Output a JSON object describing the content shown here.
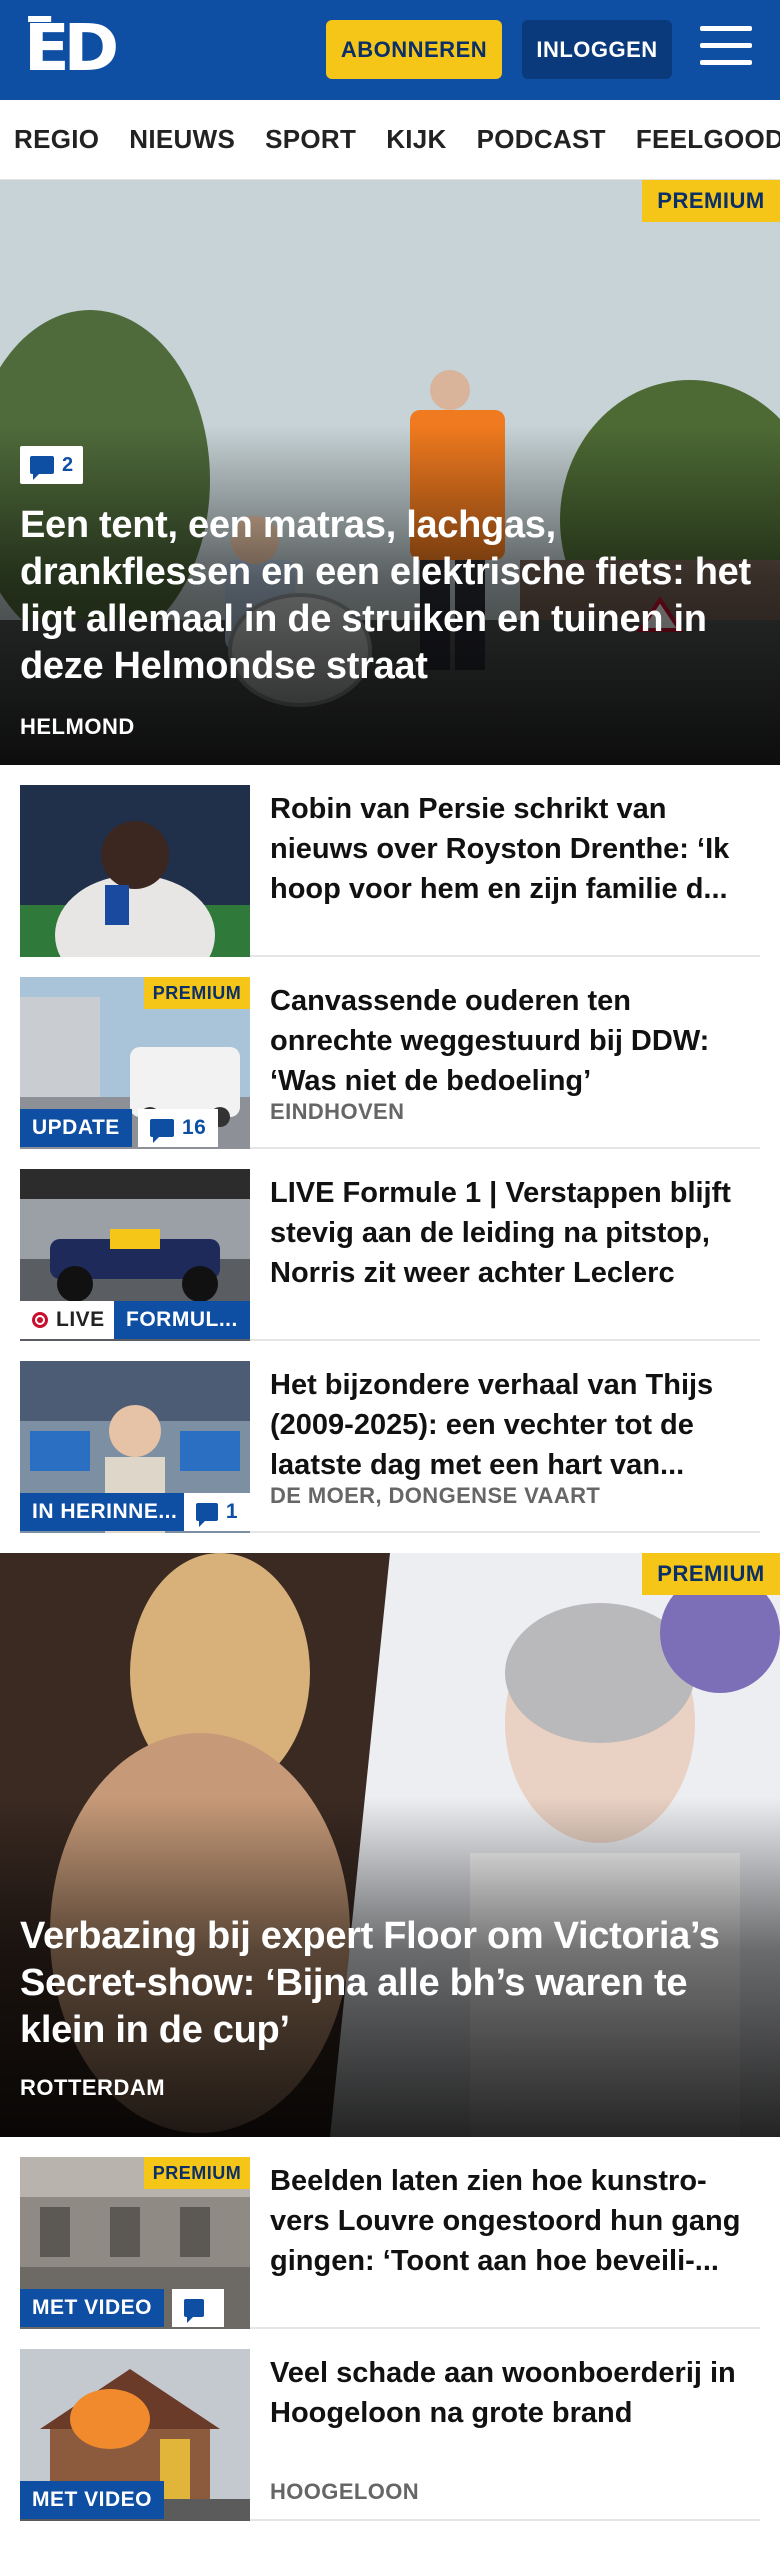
{
  "header": {
    "logo": "ED",
    "subscribe_label": "ABONNEREN",
    "login_label": "INLOGGEN",
    "accent": "#0e4fa4",
    "highlight": "#f5c518"
  },
  "nav": {
    "items": [
      "REGIO",
      "NIEUWS",
      "SPORT",
      "KIJK",
      "PODCAST",
      "FEELGOOD"
    ]
  },
  "hero1": {
    "premium_label": "PREMIUM",
    "comments": "2",
    "title": "Een tent, een matras, lachgas, drankflessen en een elektrische fiets: het ligt allemaal in de struiken en tuinen in deze Helmondse straat",
    "location": "HELMOND"
  },
  "articles": [
    {
      "title": "Robin van Persie schrikt van nieuws over Royston Drenthe: ‘Ik hoop voor hem en zijn familie d...",
      "location": ""
    },
    {
      "title": "Canvassende ouderen ten onrechte weggestuurd bij DDW: ‘Was niet de bedoeling’",
      "location": "EINDHOVEN",
      "premium_label": "PREMIUM",
      "tag": "UPDATE",
      "comments": "16"
    },
    {
      "title": "LIVE Formule 1 | Verstappen blijft stevig aan de leiding na pitstop, Norris zit weer achter Leclerc",
      "location": "",
      "live_label": "LIVE",
      "tag": "FORMUL..."
    },
    {
      "title": "Het bijzondere verhaal van Thijs (2009-2025): een vechter tot de laatste dag met een hart van...",
      "location": "DE MOER, DONGENSE VAART",
      "tag": "IN HERINNE...",
      "comments": "1"
    }
  ],
  "hero2": {
    "premium_label": "PREMIUM",
    "title": "Verbazing bij expert Floor om Victoria’s Secret-show: ‘Bijna alle bh’s waren te klein in de cup’",
    "location": "ROTTERDAM"
  },
  "articles2": [
    {
      "title": "Beelden laten zien hoe kunstro-vers Louvre ongestoord hun gang gingen: ‘Toont aan hoe beveili-...",
      "location": "",
      "premium_label": "PREMIUM",
      "tag": "MET VIDEO"
    },
    {
      "title": "Veel schade aan woonboerderij in Hoogeloon na grote brand",
      "location": "HOOGELOON",
      "tag": "MET VIDEO"
    }
  ]
}
